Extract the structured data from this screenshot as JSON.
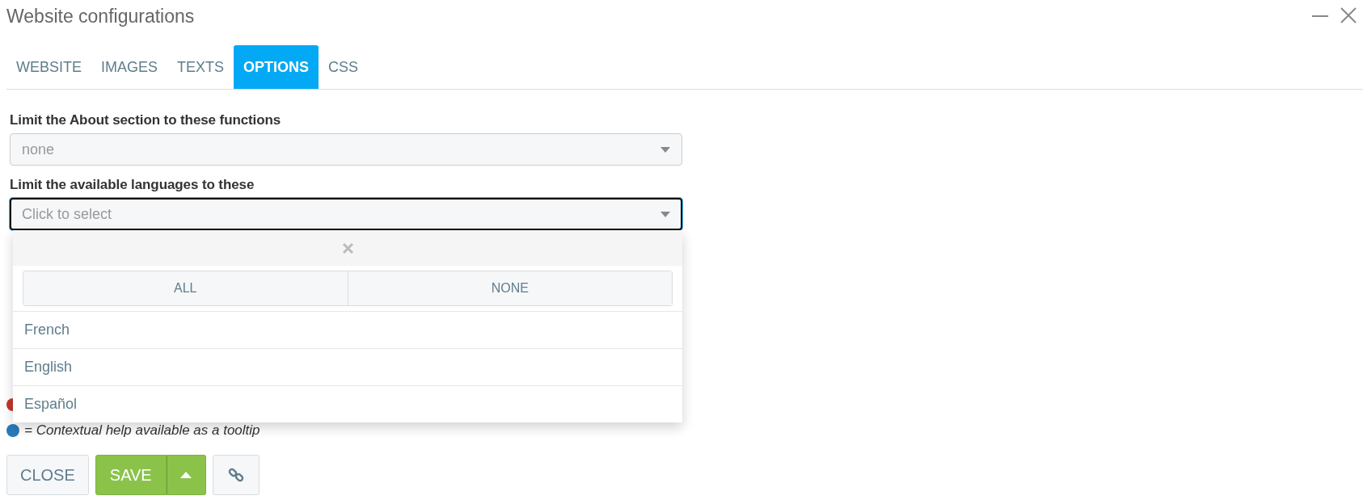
{
  "window": {
    "title": "Website configurations"
  },
  "tabs": [
    {
      "label": "WEBSITE",
      "selected": false
    },
    {
      "label": "IMAGES",
      "selected": false
    },
    {
      "label": "TEXTS",
      "selected": false
    },
    {
      "label": "OPTIONS",
      "selected": true
    },
    {
      "label": "CSS",
      "selected": false
    }
  ],
  "fields": [
    {
      "label": "Limit the About section to these functions",
      "value": "none",
      "focused": false
    },
    {
      "label": "Limit the available languages to these",
      "placeholder": "Click to select",
      "focused": true
    }
  ],
  "dropdown": {
    "buttons": [
      "ALL",
      "NONE"
    ],
    "options": [
      {
        "label": "French"
      },
      {
        "label": "English"
      },
      {
        "label": "Español"
      }
    ]
  },
  "legend": [
    {
      "color": "#c0392b"
    },
    {
      "color": "#2a7ab8",
      "text": "= Contextual help available as a tooltip"
    }
  ],
  "actions": {
    "close": "CLOSE",
    "save": "SAVE"
  }
}
